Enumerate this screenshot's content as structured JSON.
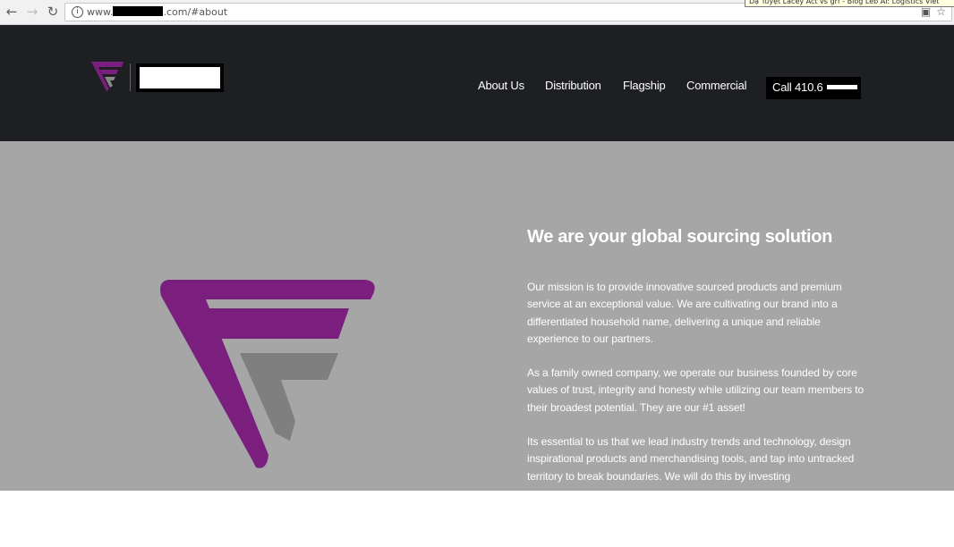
{
  "browser": {
    "url_prefix": "www.",
    "url_suffix": ".com/#about",
    "tooltip": "Dạ Tuyệt Lacey Act vs grf - Blog Leb Al: Logistics Viet"
  },
  "header": {
    "nav": [
      {
        "label": "About Us"
      },
      {
        "label": "Distribution"
      },
      {
        "label": "Flagship"
      },
      {
        "label": "Commercial"
      }
    ],
    "call_label": "Call 410.6"
  },
  "about": {
    "title": "We are your global sourcing solution",
    "paragraphs": [
      "Our mission is to provide innovative sourced products and premium service at an exceptional value. We are cultivating our brand into a differentiated household name, delivering a unique and reliable experience to our partners.",
      "As a family owned company, we operate our business founded by core values of trust, integrity and honesty while utilizing our team members to their broadest potential. They are our #1 asset!",
      "Its essential to us that we lead industry trends and technology, design inspirational products and merchandising tools, and tap into untracked territory to break boundaries. We will do this by investing"
    ]
  },
  "colors": {
    "header_bg": "#1e1f23",
    "section_bg": "#a6a6a6",
    "brand_purple": "#7a1f7e",
    "brand_gray": "#7f7f7f"
  },
  "icons": [
    "back-icon",
    "forward-icon",
    "reload-icon",
    "info-icon",
    "translate-icon",
    "star-icon"
  ]
}
